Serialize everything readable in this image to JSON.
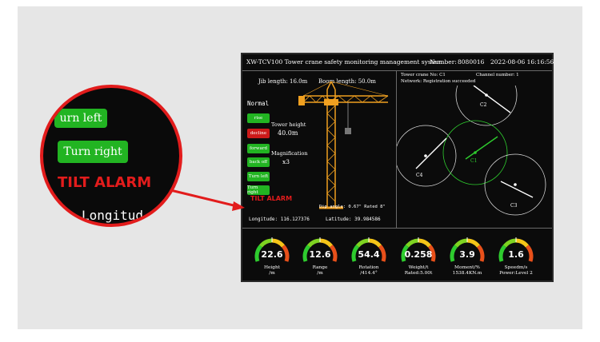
{
  "topbar": {
    "title": "XW-TCV100 Tower crane safety monitoring management system",
    "number_label": "Number:",
    "number_value": "8080016",
    "datetime": "2022-08-06  16:16:56"
  },
  "left": {
    "jib_length": "Jib length: 16.0m",
    "boom_length": "Boom length: 50.0m",
    "status": "Normal",
    "tower_height_label": "Tower height",
    "tower_height_value": "40.0m",
    "magnification_label": "Magnification",
    "magnification_value": "x3",
    "tilt_alarm": "TILT ALARM",
    "dip_angle": "Dip angle: 0.67\"  Rated 8\"",
    "longitude": "Longitude: 116.127376",
    "latitude": "Latitude: 39.984586"
  },
  "controls": [
    {
      "label": "rise",
      "state": "green"
    },
    {
      "label": "decline",
      "state": "red"
    },
    {
      "label": "forward",
      "state": "green"
    },
    {
      "label": "back off",
      "state": "green"
    },
    {
      "label": "Turn left",
      "state": "green"
    },
    {
      "label": "Turn right",
      "state": "green"
    }
  ],
  "right": {
    "tower_crane_no": "Tower crane No:  C1",
    "channel_number": "Channel number:  1",
    "network": "Network: Registration succeeded",
    "cranes": [
      "C2",
      "C4",
      "C1",
      "C3"
    ]
  },
  "gauges": [
    {
      "value": "22.6",
      "label1": "Height",
      "label2": "/m"
    },
    {
      "value": "12.6",
      "label1": "Range",
      "label2": "/m"
    },
    {
      "value": "54.4",
      "label1": "Rotation",
      "label2": "/414.4°"
    },
    {
      "value": "0.258",
      "label1": "Weight/t",
      "label2": "Rated:5.00t"
    },
    {
      "value": "3.9",
      "label1": "Moment/%",
      "label2": "1538.4KN.m"
    },
    {
      "value": "1.6",
      "label1": "Speedm/s",
      "label2": "Power:Level 2"
    }
  ],
  "magnifier": {
    "turn_left": "urn left",
    "turn_right": "Turn right",
    "tilt_alarm": "TILT ALARM",
    "longitude": "Longitud"
  },
  "colors": {
    "accent_green": "#22b422",
    "alarm_red": "#e21c1c",
    "crane_orange": "#f0a020"
  }
}
